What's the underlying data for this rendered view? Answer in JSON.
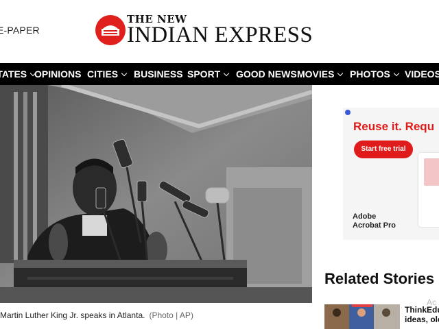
{
  "header": {
    "epaper_label": "E-PAPER",
    "logo_top": "THE NEW",
    "logo_main": "INDIAN EXPRESS"
  },
  "nav": {
    "items": [
      {
        "label": "STATES",
        "dropdown": true
      },
      {
        "label": "OPINIONS",
        "dropdown": false
      },
      {
        "label": "CITIES",
        "dropdown": true
      },
      {
        "label": "BUSINESS",
        "dropdown": false
      },
      {
        "label": "SPORT",
        "dropdown": true
      },
      {
        "label": "GOOD NEWS",
        "dropdown": false
      },
      {
        "label": "MOVIES",
        "dropdown": true
      },
      {
        "label": "PHOTOS",
        "dropdown": true
      },
      {
        "label": "VIDEOS",
        "dropdown": true
      }
    ]
  },
  "article": {
    "caption": "Martin Luther King Jr. speaks in Atlanta.",
    "photo_credit": "(Photo | AP)"
  },
  "ad": {
    "headline": "Reuse it. Requ",
    "cta": "Start free trial",
    "brand_line1": "Adobe",
    "brand_line2": "Acrobat Pro",
    "colors": {
      "accent": "#e01b1b"
    }
  },
  "related": {
    "heading": "Related Stories",
    "ac_text": "Ac",
    "stories": [
      {
        "title_line1": "ThinkEdu",
        "title_line2": "ideas, old"
      }
    ]
  },
  "colors": {
    "nav_bg": "#000000",
    "logo_red": "#e0201c"
  }
}
